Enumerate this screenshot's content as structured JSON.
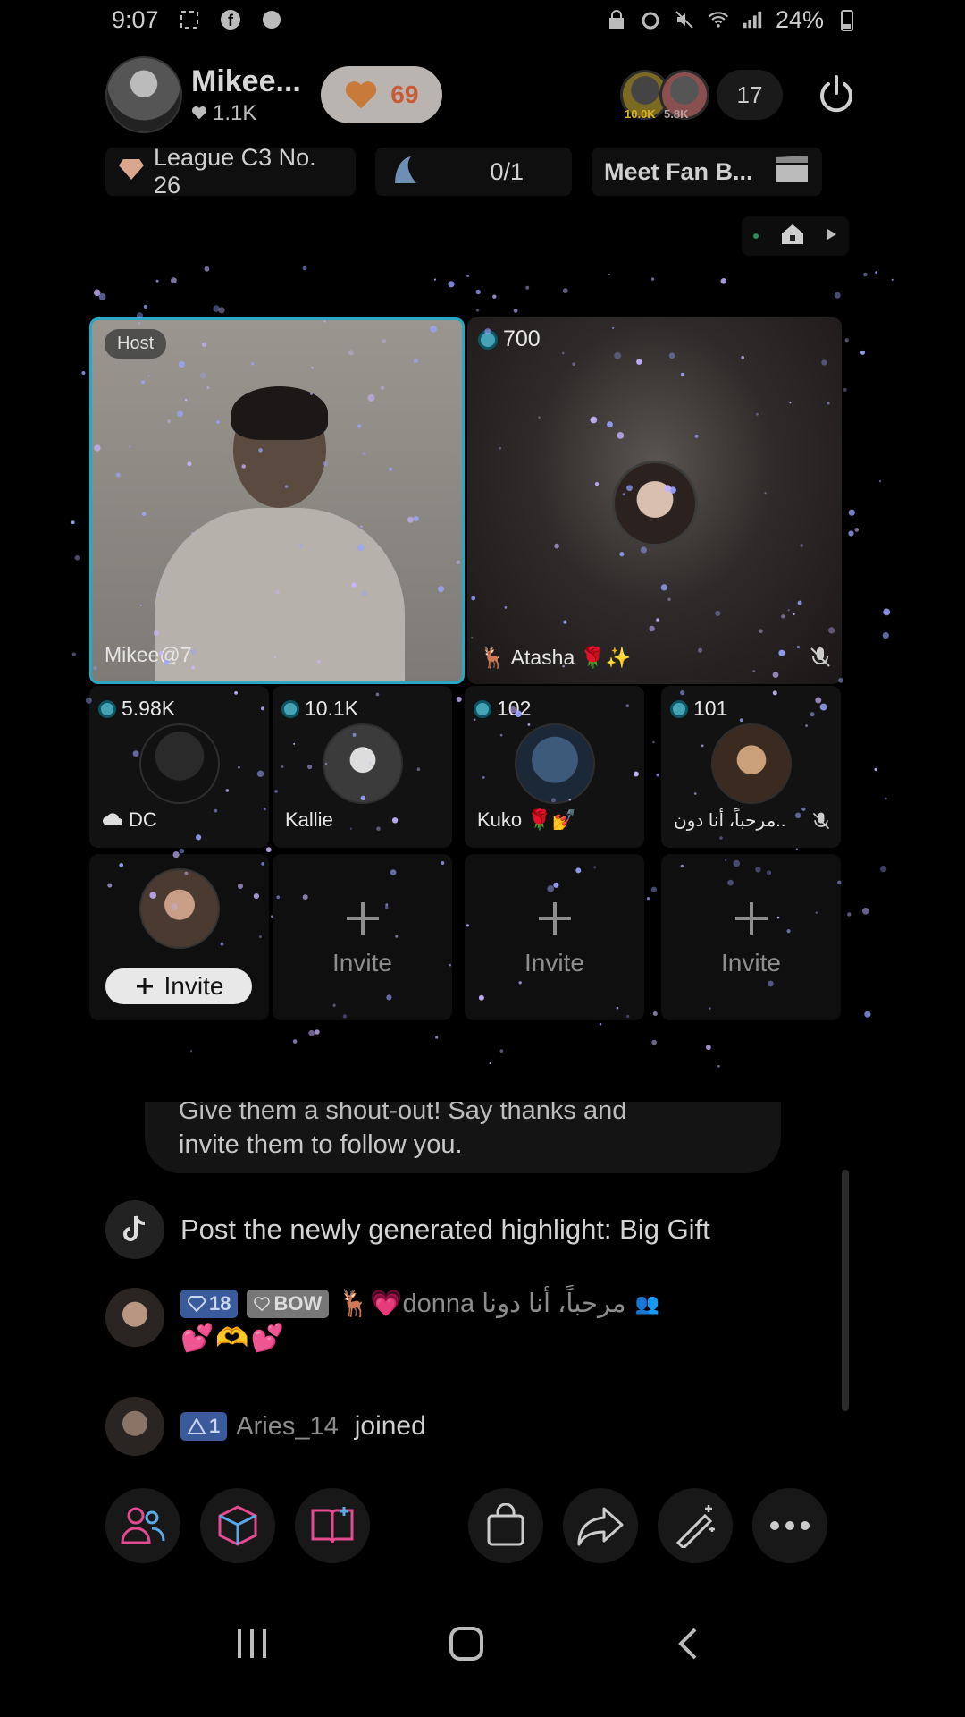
{
  "status_bar": {
    "time": "9:07",
    "battery": "24%"
  },
  "header": {
    "host_name": "Mikee...",
    "host_likes": "1.1K",
    "gift_count": "69",
    "viewer_badges": [
      "10.0K",
      "5.8K"
    ],
    "viewer_count": "17"
  },
  "info_row": {
    "league": "League C3 No. 26",
    "goal": "0/1",
    "fan_event": "Meet Fan B..."
  },
  "tiles": {
    "host_badge": "Host",
    "host_name": "Mikee@7",
    "atasha": {
      "score": "700",
      "name": "Atasha",
      "emoji": "🌹✨"
    },
    "small": [
      {
        "score": "5.98K",
        "name": "DC"
      },
      {
        "score": "10.1K",
        "name": "Kallie"
      },
      {
        "score": "102",
        "name": "Kuko",
        "emoji": "🌹💅"
      },
      {
        "score": "101",
        "name": "مرحباً، أنا دون.."
      }
    ],
    "invite_label": "Invite"
  },
  "chat": {
    "shoutout_line1": "Give them a shout-out! Say thanks and",
    "shoutout_line2": "invite them to follow you.",
    "highlight": "Post the newly generated highlight: Big Gift",
    "donna": {
      "level": "18",
      "fan_badge": "BOW",
      "user": "🦌💗donna مرحباً، أنا دونا",
      "comment": "💕🫶💕"
    },
    "aries": {
      "level": "1",
      "user": "Aries_14",
      "joined": "joined"
    }
  },
  "icons": {
    "bottom_bar": [
      "people-icon",
      "box-icon",
      "book-add-icon",
      "bag-icon",
      "share-icon",
      "magic-wand-icon",
      "more-icon"
    ],
    "nav": [
      "recents-icon",
      "home-icon",
      "back-icon"
    ]
  },
  "colors": {
    "host_border": "#2aa7c2",
    "gift_count": "#c85a34",
    "level_badge": "#3b5a9b",
    "bottom_icon_pink": "#e24b8f",
    "bottom_icon_blue": "#5aa9e6"
  }
}
